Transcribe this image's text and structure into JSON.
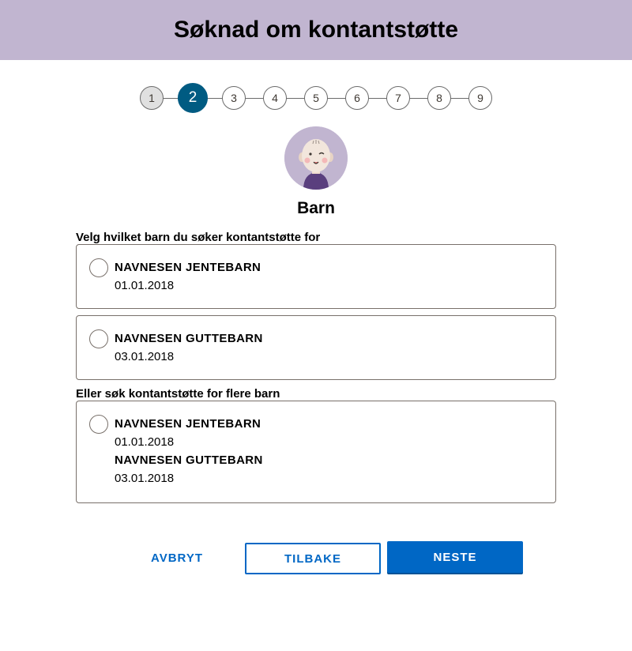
{
  "header": {
    "title": "Søknad om kontantstøtte"
  },
  "stepper": {
    "steps": [
      "1",
      "2",
      "3",
      "4",
      "5",
      "6",
      "7",
      "8",
      "9"
    ],
    "current": 2
  },
  "section": {
    "title": "Barn"
  },
  "single_choice": {
    "label": "Velg hvilket barn du søker kontantstøtte for",
    "options": [
      {
        "name": "NAVNESEN JENTEBARN",
        "date": "01.01.2018"
      },
      {
        "name": "NAVNESEN GUTTEBARN",
        "date": "03.01.2018"
      }
    ]
  },
  "multi_choice": {
    "label": "Eller søk kontantstøtte for flere barn",
    "children": [
      {
        "name": "NAVNESEN JENTEBARN",
        "date": "01.01.2018"
      },
      {
        "name": "NAVNESEN GUTTEBARN",
        "date": "03.01.2018"
      }
    ]
  },
  "buttons": {
    "cancel": "AVBRYT",
    "back": "TILBAKE",
    "next": "NESTE"
  },
  "colors": {
    "header_bg": "#c1b5d0",
    "active_step": "#005b82",
    "primary": "#0067c5"
  },
  "icons": {
    "avatar": "baby-avatar-icon"
  }
}
